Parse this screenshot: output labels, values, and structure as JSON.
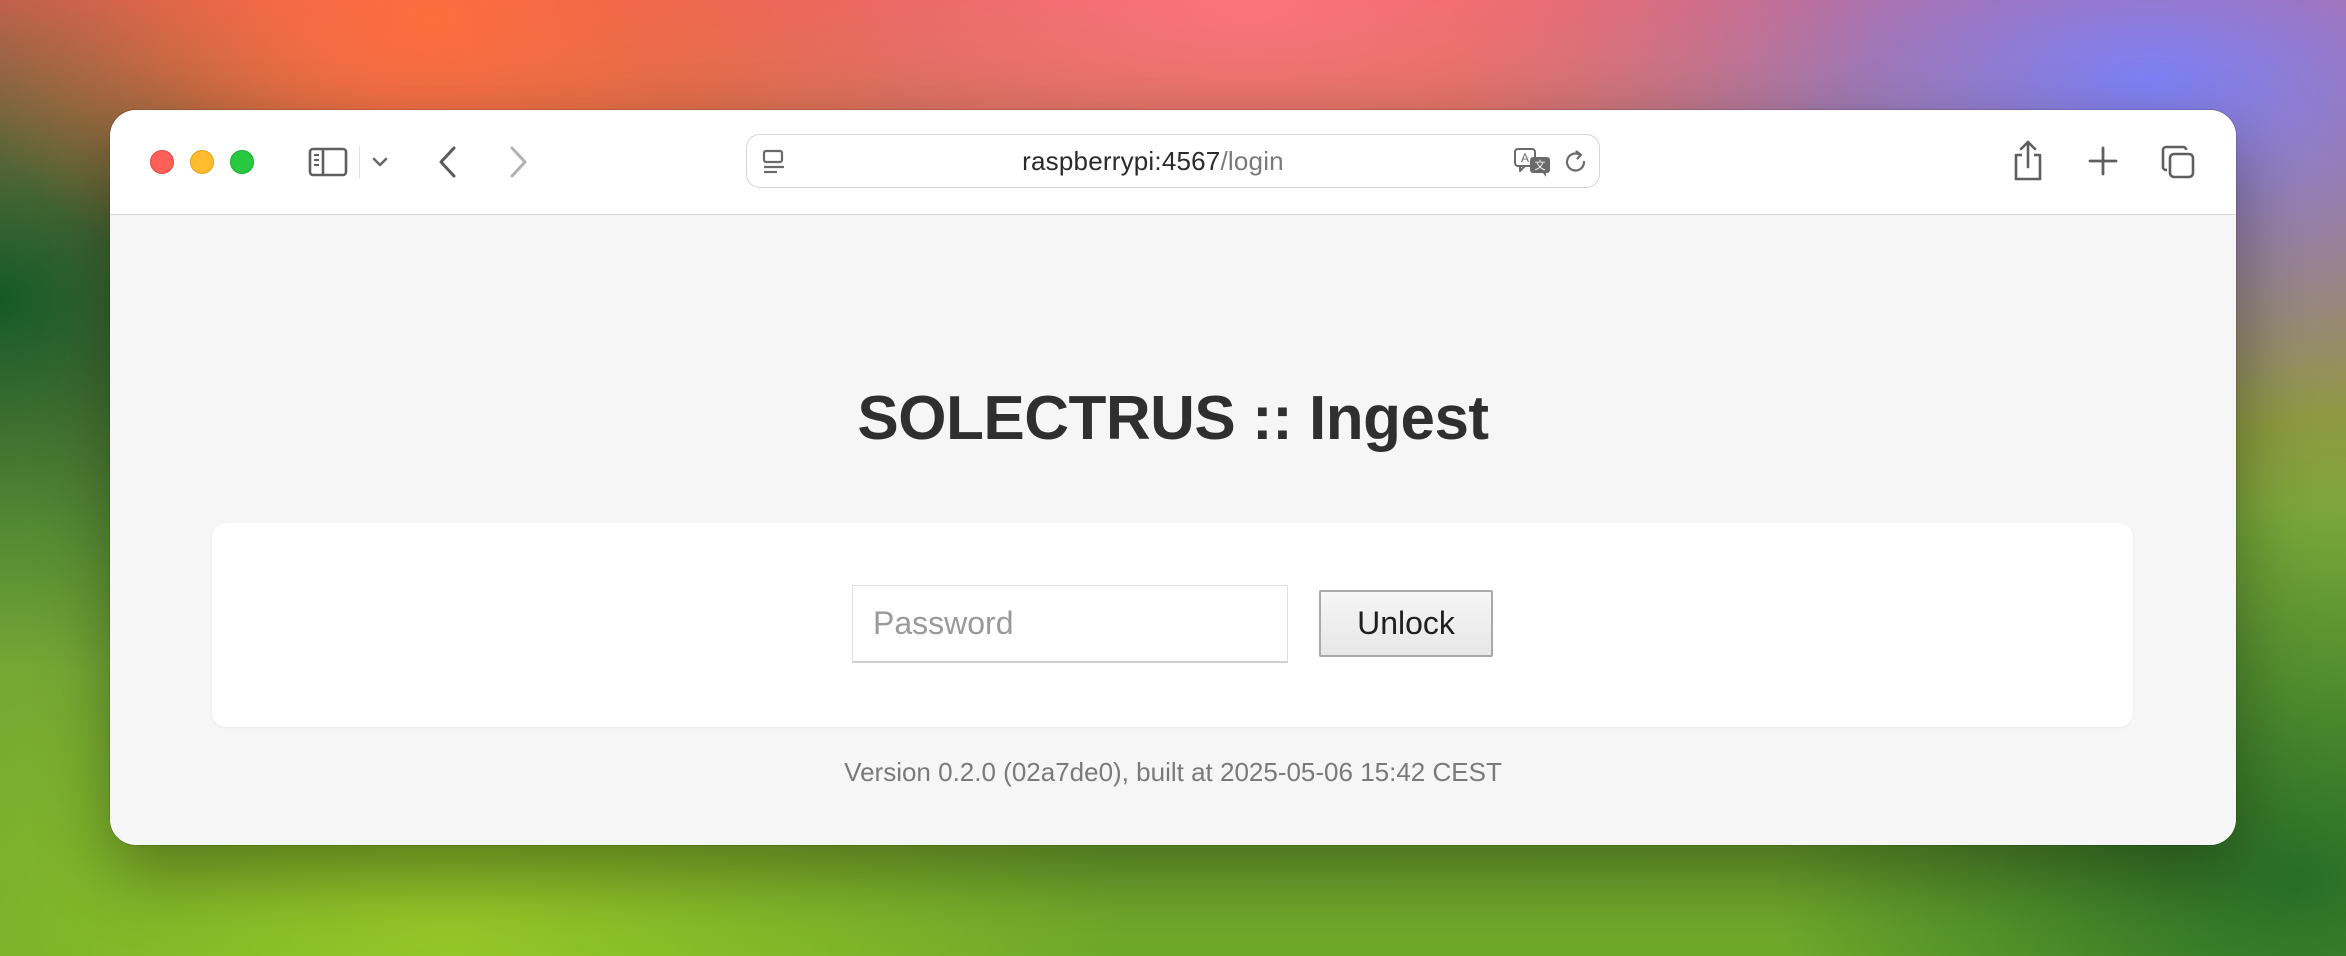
{
  "browser": {
    "url_host": "raspberrypi:4567",
    "url_path": "/login"
  },
  "page": {
    "title": "SOLECTRUS :: Ingest",
    "password_placeholder": "Password",
    "password_value": "",
    "unlock_label": "Unlock",
    "version_text": "Version 0.2.0 (02a7de0), built at 2025-05-06 15:42 CEST"
  },
  "icons": {
    "sidebar": "sidebar-icon",
    "sidebar_menu": "chevron-down-icon",
    "back": "chevron-left-icon",
    "forward": "chevron-right-icon",
    "reader": "reader-mode-icon",
    "translate": "translate-icon",
    "reload": "reload-icon",
    "share": "share-icon",
    "new_tab": "plus-icon",
    "tab_overview": "tabs-overview-icon"
  },
  "colors": {
    "traffic_close": "#ff5f57",
    "traffic_minimize": "#febc2e",
    "traffic_maximize": "#28c840",
    "page_background": "#f6f6f6",
    "title_text": "#2f2f2f"
  }
}
